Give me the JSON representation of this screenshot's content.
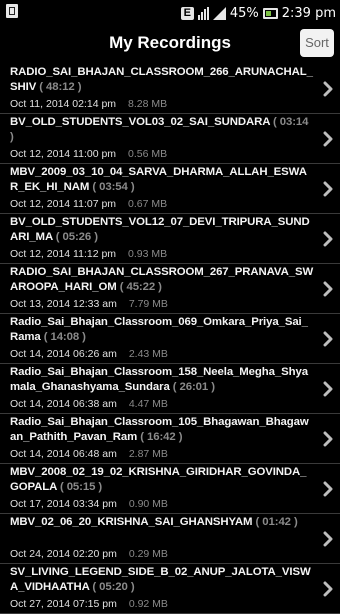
{
  "status_bar": {
    "battery": "45%",
    "time": "2:39 pm",
    "network_letter": "E"
  },
  "header": {
    "title": "My Recordings",
    "sort_label": "Sort"
  },
  "recordings": [
    {
      "name": "RADIO_SAI_BHAJAN_CLASSROOM_266_ARUNACHAL_SHIV",
      "duration": "( 48:12 )",
      "date": "Oct 11, 2014 02:14 pm",
      "size": "8.28 MB"
    },
    {
      "name": "BV_OLD_STUDENTS_VOL03_02_SAI_SUNDARA",
      "duration": "( 03:14 )",
      "date": "Oct 12, 2014 11:00 pm",
      "size": "0.56 MB"
    },
    {
      "name": "MBV_2009_03_10_04_SARVA_DHARMA_ALLAH_ESWAR_EK_HI_NAM",
      "duration": "( 03:54 )",
      "date": "Oct 12, 2014 11:07 pm",
      "size": "0.67 MB"
    },
    {
      "name": "BV_OLD_STUDENTS_VOL12_07_DEVI_TRIPURA_SUNDARI_MA",
      "duration": "( 05:26 )",
      "date": "Oct 12, 2014 11:12 pm",
      "size": "0.93 MB"
    },
    {
      "name": "RADIO_SAI_BHAJAN_CLASSROOM_267_PRANAVA_SWAROOPA_HARI_OM",
      "duration": "( 45:22 )",
      "date": "Oct 13, 2014 12:33 am",
      "size": "7.79 MB"
    },
    {
      "name": "Radio_Sai_Bhajan_Classroom_069_Omkara_Priya_Sai_Rama",
      "duration": "( 14:08 )",
      "date": "Oct 14, 2014 06:26 am",
      "size": "2.43 MB"
    },
    {
      "name": "Radio_Sai_Bhajan_Classroom_158_Neela_Megha_Shyamala_Ghanashyama_Sundara",
      "duration": "( 26:01 )",
      "date": "Oct 14, 2014 06:38 am",
      "size": "4.47 MB"
    },
    {
      "name": "Radio_Sai_Bhajan_Classroom_105_Bhagawan_Bhagawan_Pathith_Pavan_Ram",
      "duration": "( 16:42 )",
      "date": "Oct 14, 2014 06:48 am",
      "size": "2.87 MB"
    },
    {
      "name": "MBV_2008_02_19_02_KRISHNA_GIRIDHAR_GOVINDA_GOPALA",
      "duration": "( 05:15 )",
      "date": "Oct 17, 2014 03:34 pm",
      "size": "0.90 MB"
    },
    {
      "name": "MBV_02_06_20_KRISHNA_SAI_GHANSHYAM",
      "duration": "( 01:42 )",
      "date": "Oct 24, 2014 02:20 pm",
      "size": "0.29 MB"
    },
    {
      "name": "SV_LIVING_LEGEND_SIDE_B_02_ANUP_JALOTA_VISWA_VIDHAATHA",
      "duration": "( 05:20 )",
      "date": "Oct 27, 2014 07:15 pm",
      "size": "0.92 MB"
    }
  ]
}
